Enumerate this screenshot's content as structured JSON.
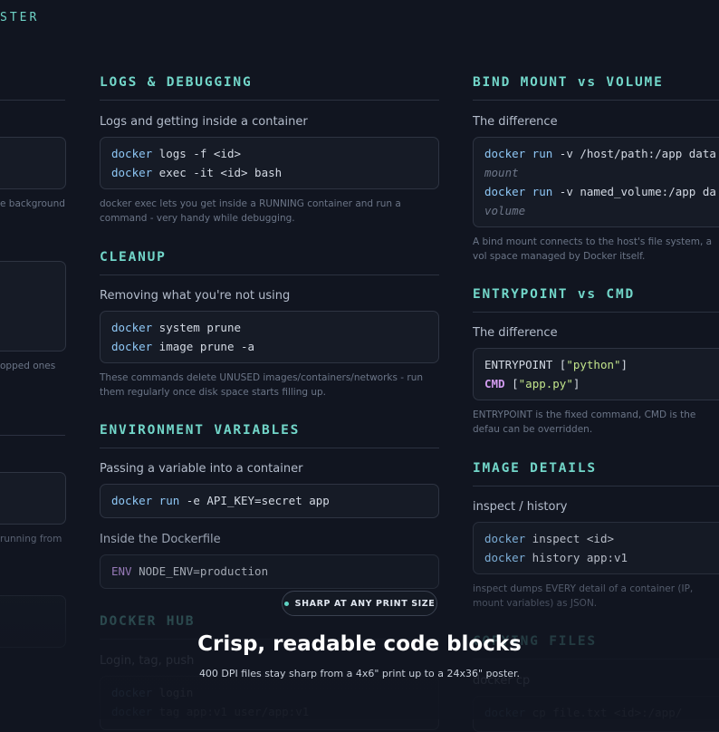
{
  "brand": "STER",
  "left_col": {
    "note1": "e background",
    "note2": "opped ones",
    "note3": "running from"
  },
  "mid_col": {
    "logs": {
      "title": "LOGS & DEBUGGING",
      "label": "Logs and getting inside a container",
      "line1_kw": "docker",
      "line1_rest": " logs -f <id>",
      "line2_kw": "docker",
      "line2_rest": " exec -it <id> bash",
      "note": "docker exec lets you get inside a RUNNING container and run a command - very handy while debugging."
    },
    "cleanup": {
      "title": "CLEANUP",
      "label": "Removing what you're not using",
      "line1_kw": "docker",
      "line1_rest": " system prune",
      "line2_kw": "docker",
      "line2_rest": " image prune -a",
      "note": "These commands delete UNUSED images/containers/networks - run them regularly once disk space starts filling up."
    },
    "env": {
      "title": "ENVIRONMENT VARIABLES",
      "label": "Passing a variable into a container",
      "line_kw": "docker run",
      "line_rest": " -e API_KEY=secret app",
      "label2": "Inside the Dockerfile",
      "line2_kw": "ENV",
      "line2_rest": " NODE_ENV=production"
    },
    "hub": {
      "title": "DOCKER HUB",
      "label": "Login, tag, push",
      "line1_kw": "docker",
      "line1_rest": " login",
      "line2_kw": "docker",
      "line2_rest": " tag app:v1 user/app:v1"
    }
  },
  "right_col": {
    "bind": {
      "title": "BIND MOUNT vs VOLUME",
      "label": "The difference",
      "line1_kw": "docker run",
      "line1_rest": " -v /host/path:/app data",
      "line2": "mount",
      "line3_kw": "docker run",
      "line3_rest": " -v named_volume:/app da",
      "line4": "volume",
      "note": "A bind mount connects to the host's file system, a vol space managed by Docker itself."
    },
    "entry": {
      "title": "ENTRYPOINT vs CMD",
      "label": "The difference",
      "line1_a": "ENTRYPOINT [",
      "line1_str": "\"python\"",
      "line1_b": "]",
      "line2_kw": "CMD",
      "line2_a": " [",
      "line2_str": "\"app.py\"",
      "line2_b": "]",
      "note": "ENTRYPOINT is the fixed command, CMD is the defau can be overridden."
    },
    "image": {
      "title": "IMAGE DETAILS",
      "label": "inspect / history",
      "line1_kw": "docker",
      "line1_rest": " inspect <id>",
      "line2_kw": "docker",
      "line2_rest": " history app:v1",
      "note": "inspect dumps EVERY detail of a container (IP, mount variables) as JSON."
    },
    "copy": {
      "title": "COPYING FILES",
      "label": "docker cp",
      "line_kw": "docker",
      "line_rest": " cp file.txt <id>:/app/"
    }
  },
  "overlay": {
    "pill": "SHARP AT ANY PRINT SIZE",
    "headline": "Crisp, readable code blocks",
    "subline": "400 DPI files stay sharp from a 4x6\" print up to a 24x36\" poster."
  },
  "colors": {
    "accent": "#72d6c9",
    "background": "#111520",
    "keyword": "#8ec7f5",
    "string": "#c2e58b"
  }
}
